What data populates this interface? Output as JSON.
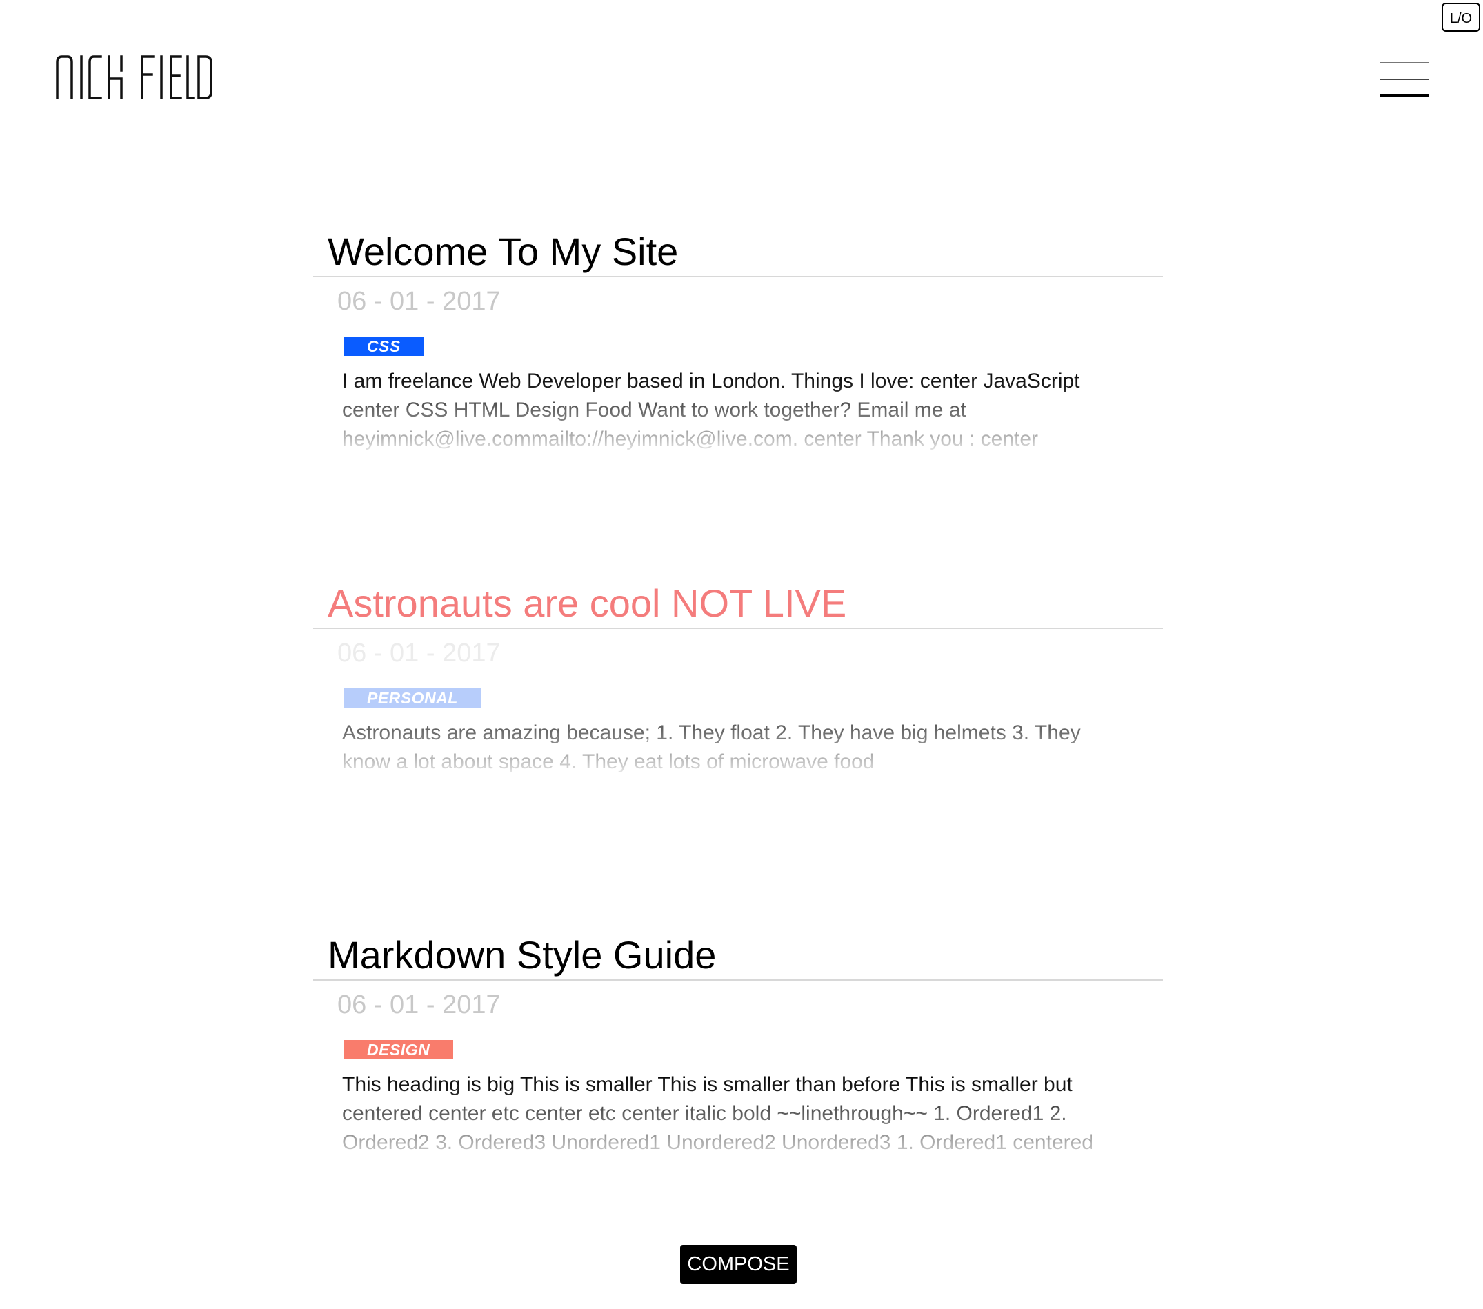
{
  "site": {
    "logo_text": "NICKFIELD",
    "login_label": "L/O"
  },
  "posts": [
    {
      "title": "Welcome To My Site",
      "date": "06 - 01 - 2017",
      "tag": "CSS",
      "tag_color": "#0a5cff",
      "body": "I am freelance Web Developer based in London. Things I love: center JavaScript center CSS HTML Design Food Want to work together? Email me at heyimnick@live.commailto://heyimnick@live.com. center Thank you : center",
      "live": true
    },
    {
      "title": "Astronauts are cool NOT LIVE",
      "date": "06 - 01 - 2017",
      "tag": "PERSONAL",
      "tag_color": "#b7cdfb",
      "body": "Astronauts are amazing because; 1. They float 2. They have big helmets 3. They know a lot about space 4. They eat lots of microwave food",
      "live": false
    },
    {
      "title": "Markdown Style Guide",
      "date": "06 - 01 - 2017",
      "tag": "DESIGN",
      "tag_color": "#f97c6c",
      "body": "This heading is big This is smaller This is smaller than before This is smaller but centered center etc center etc center italic bold ~~linethrough~~ 1. Ordered1 2. Ordered2 3. Ordered3 Unordered1 Unordered2 Unordered3 1. Ordered1 centered",
      "live": true
    }
  ],
  "compose_label": "COMPOSE"
}
